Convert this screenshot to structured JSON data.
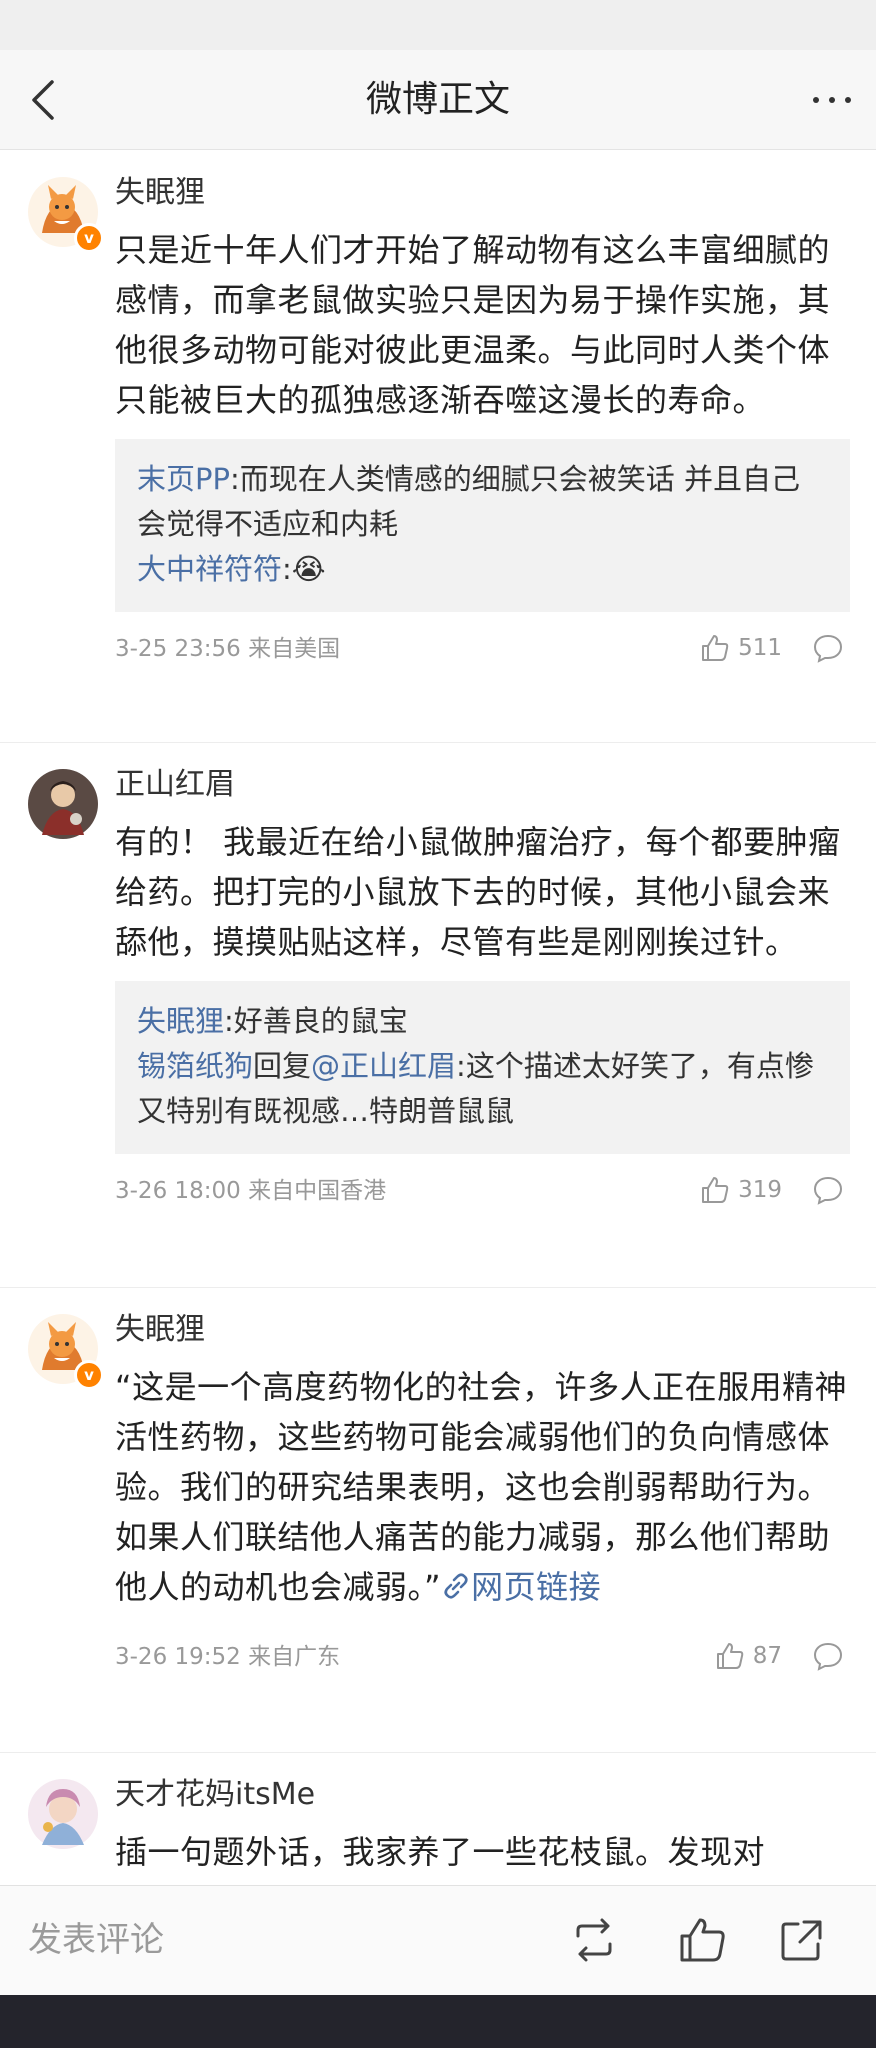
{
  "nav": {
    "title": "微博正文"
  },
  "comments": [
    {
      "user": "失眠狸",
      "verified": true,
      "text": "只是近十年人们才开始了解动物有这么丰富细腻的感情，而拿老鼠做实验只是因为易于操作实施，其他很多动物可能对彼此更温柔。与此同时人类个体只能被巨大的孤独感逐渐吞噬这漫长的寿命。",
      "replies": [
        {
          "name": "末页PP",
          "text": ":而现在人类情感的细腻只会被笑话 并且自己会觉得不适应和内耗"
        },
        {
          "name": "大中祥符符",
          "text": ":😭"
        }
      ],
      "time": "3-25 23:56 来自美国",
      "likes": "511"
    },
    {
      "user": "正山红眉",
      "verified": false,
      "text": "有的！ 我最近在给小鼠做肿瘤治疗，每个都要肿瘤给药。把打完的小鼠放下去的时候，其他小鼠会来舔他，摸摸贴贴这样，尽管有些是刚刚挨过针。",
      "replies": [
        {
          "name": "失眠狸",
          "text": ":好善良的鼠宝"
        },
        {
          "name": "锡箔纸狗",
          "mid": "回复",
          "mention": "@正山红眉",
          "text": ":这个描述太好笑了，有点惨又特别有既视感…特朗普鼠鼠"
        }
      ],
      "time": "3-26 18:00 来自中国香港",
      "likes": "319"
    },
    {
      "user": "失眠狸",
      "verified": true,
      "text": "“这是一个高度药物化的社会，许多人正在服用精神活性药物，这些药物可能会减弱他们的负向情感体验。我们的研究结果表明，这也会削弱帮助行为。如果人们联结他人痛苦的能力减弱，那么他们帮助他人的动机也会减弱。”",
      "link_text": "网页链接",
      "time": "3-26 19:52 来自广东",
      "likes": "87"
    },
    {
      "user": "天才花妈itsMe",
      "verified": false,
      "text": "插一句题外话，我家养了一些花枝鼠。发现对"
    }
  ],
  "bottom": {
    "placeholder": "发表评论"
  },
  "colors": {
    "link": "#4a6fa5",
    "verified_badge": "#ff8200",
    "meta": "#999999"
  },
  "icons": {
    "back": "chevron-left-icon",
    "more": "more-dots-icon",
    "like": "thumbs-up-icon",
    "comment": "comment-bubble-icon",
    "repost": "repost-icon",
    "share": "share-icon",
    "link": "link-icon"
  }
}
